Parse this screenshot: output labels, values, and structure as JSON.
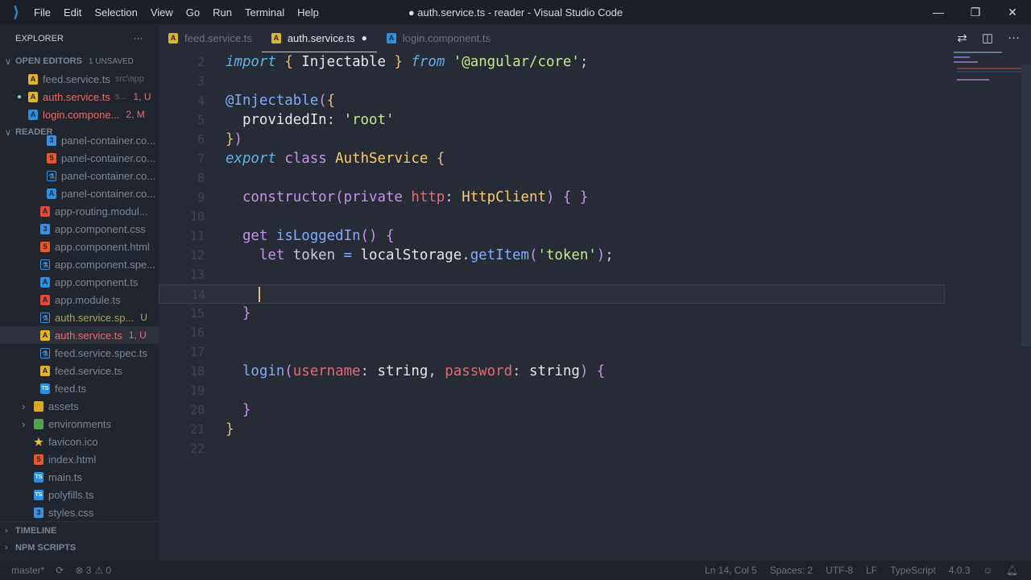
{
  "titlebar": {
    "title": "● auth.service.ts - reader - Visual Studio Code",
    "menu": [
      "File",
      "Edit",
      "Selection",
      "View",
      "Go",
      "Run",
      "Terminal",
      "Help"
    ]
  },
  "sidebar": {
    "explorer_label": "EXPLORER",
    "more": "···",
    "open_editors": {
      "label": "OPEN EDITORS",
      "sub": "1 UNSAVED",
      "items": [
        {
          "name": "feed.service.ts",
          "desc": "src\\app",
          "icon": "ang",
          "badge": "",
          "color": ""
        },
        {
          "name": "auth.service.ts",
          "desc": "s...",
          "icon": "ang",
          "badge": "1, U",
          "color": "red",
          "dirty": true
        },
        {
          "name": "login.compone...",
          "desc": "",
          "icon": "angb",
          "badge": "2, M",
          "color": "red"
        }
      ]
    },
    "reader": {
      "label": "READER",
      "items": [
        {
          "name": "panel-container.co...",
          "icon": "css",
          "indent": 2
        },
        {
          "name": "panel-container.co...",
          "icon": "html",
          "indent": 2
        },
        {
          "name": "panel-container.co...",
          "icon": "spec",
          "indent": 2
        },
        {
          "name": "panel-container.co...",
          "icon": "angb",
          "indent": 2
        },
        {
          "name": "app-routing.modul...",
          "icon": "angr",
          "indent": 1
        },
        {
          "name": "app.component.css",
          "icon": "css",
          "indent": 1
        },
        {
          "name": "app.component.html",
          "icon": "html",
          "indent": 1
        },
        {
          "name": "app.component.spe...",
          "icon": "spec",
          "indent": 1
        },
        {
          "name": "app.component.ts",
          "icon": "angb",
          "indent": 1
        },
        {
          "name": "app.module.ts",
          "icon": "angr",
          "indent": 1
        },
        {
          "name": "auth.service.sp...",
          "icon": "spec",
          "indent": 1,
          "badge": "U",
          "color": "olive"
        },
        {
          "name": "auth.service.ts",
          "icon": "ang",
          "indent": 1,
          "badge": "1, U",
          "color": "red",
          "active": true
        },
        {
          "name": "feed.service.spec.ts",
          "icon": "spec",
          "indent": 1
        },
        {
          "name": "feed.service.ts",
          "icon": "ang",
          "indent": 1
        },
        {
          "name": "feed.ts",
          "icon": "ts",
          "indent": 1
        },
        {
          "name": "assets",
          "icon": "fold",
          "indent": 0,
          "folder": true
        },
        {
          "name": "environments",
          "icon": "foldg",
          "indent": 0,
          "folder": true
        },
        {
          "name": "favicon.ico",
          "icon": "star",
          "indent": 0
        },
        {
          "name": "index.html",
          "icon": "html",
          "indent": 0
        },
        {
          "name": "main.ts",
          "icon": "ts",
          "indent": 0
        },
        {
          "name": "polyfills.ts",
          "icon": "ts",
          "indent": 0
        },
        {
          "name": "styles.css",
          "icon": "css",
          "indent": 0
        }
      ]
    },
    "timeline": "TIMELINE",
    "npm": "NPM SCRIPTS"
  },
  "tabs": [
    {
      "label": "feed.service.ts",
      "icon": "ang"
    },
    {
      "label": "auth.service.ts",
      "icon": "ang",
      "active": true,
      "dirty": "●"
    },
    {
      "label": "login.component.ts",
      "icon": "angb"
    }
  ],
  "colors": {
    "kw": "#5fb3e8",
    "brace": "#e5c07b",
    "id": "#e6e6e6",
    "str": "#c3e88d",
    "fn": "#82aaff",
    "pur": "#c792ea",
    "cls": "#ffcb6b",
    "par": "#e06c75",
    "pl": "#c8ccd4"
  },
  "code": [
    {
      "n": "2",
      "t": [
        [
          "import",
          "kw",
          1
        ],
        [
          " "
        ],
        [
          "{",
          "brace"
        ],
        [
          " Injectable ",
          "id"
        ],
        [
          "}",
          "brace"
        ],
        [
          " "
        ],
        [
          "from",
          "kw",
          1
        ],
        [
          " "
        ],
        [
          "'@angular/core'",
          "str"
        ],
        [
          ";",
          "pl"
        ]
      ]
    },
    {
      "n": "3",
      "t": []
    },
    {
      "n": "4",
      "t": [
        [
          "@Injectable",
          "fn"
        ],
        [
          "(",
          "pur"
        ],
        [
          "{",
          "brace"
        ]
      ]
    },
    {
      "n": "5",
      "t": [
        [
          "  providedIn",
          "id"
        ],
        [
          ": ",
          "pl"
        ],
        [
          "'root'",
          "str"
        ]
      ]
    },
    {
      "n": "6",
      "t": [
        [
          "}",
          "brace"
        ],
        [
          ")",
          "pur"
        ]
      ]
    },
    {
      "n": "7",
      "t": [
        [
          "export",
          "kw",
          1
        ],
        [
          " "
        ],
        [
          "class",
          "pur"
        ],
        [
          " "
        ],
        [
          "AuthService",
          "cls"
        ],
        [
          " "
        ],
        [
          "{",
          "brace"
        ]
      ]
    },
    {
      "n": "8",
      "t": []
    },
    {
      "n": "9",
      "t": [
        [
          "  constructor",
          "pur"
        ],
        [
          "(",
          "pur"
        ],
        [
          "private",
          "pur"
        ],
        [
          " "
        ],
        [
          "http",
          "par"
        ],
        [
          ": ",
          "pl"
        ],
        [
          "HttpClient",
          "cls"
        ],
        [
          ")",
          "pur"
        ],
        [
          " "
        ],
        [
          "{ }",
          "pur"
        ]
      ]
    },
    {
      "n": "10",
      "t": []
    },
    {
      "n": "11",
      "t": [
        [
          "  get",
          "pur"
        ],
        [
          " "
        ],
        [
          "isLoggedIn",
          "fn"
        ],
        [
          "()",
          "pur"
        ],
        [
          " "
        ],
        [
          "{",
          "pur"
        ]
      ]
    },
    {
      "n": "12",
      "t": [
        [
          "    let",
          "pur"
        ],
        [
          " token ",
          "pl"
        ],
        [
          "=",
          "fn"
        ],
        [
          " localStorage",
          "id"
        ],
        [
          ".",
          "pl"
        ],
        [
          "getItem",
          "fn"
        ],
        [
          "(",
          "pur"
        ],
        [
          "'token'",
          "str"
        ],
        [
          ")",
          "pur"
        ],
        [
          ";",
          "pl"
        ]
      ]
    },
    {
      "n": "13",
      "t": []
    },
    {
      "n": "14",
      "t": [],
      "cur": true
    },
    {
      "n": "15",
      "t": [
        [
          "  }",
          "pur"
        ]
      ]
    },
    {
      "n": "16",
      "t": []
    },
    {
      "n": "17",
      "t": []
    },
    {
      "n": "18",
      "t": [
        [
          "  login",
          "fn"
        ],
        [
          "(",
          "pur"
        ],
        [
          "username",
          "par"
        ],
        [
          ": ",
          "pl"
        ],
        [
          "string",
          "id"
        ],
        [
          ", ",
          "pl"
        ],
        [
          "password",
          "par"
        ],
        [
          ": ",
          "pl"
        ],
        [
          "string",
          "id"
        ],
        [
          ")",
          "pur"
        ],
        [
          " "
        ],
        [
          "{",
          "pur"
        ]
      ]
    },
    {
      "n": "19",
      "t": []
    },
    {
      "n": "20",
      "t": [
        [
          "  }",
          "pur"
        ]
      ]
    },
    {
      "n": "21",
      "t": [
        [
          "}",
          "brace"
        ]
      ]
    },
    {
      "n": "22",
      "t": []
    }
  ],
  "status": {
    "branch": "master*",
    "sync": "⟳",
    "errors": "⊗ 3",
    "warnings": "⚠ 0",
    "position": "Ln 14, Col 5",
    "spaces": "Spaces: 2",
    "encoding": "UTF-8",
    "eol": "LF",
    "language": "TypeScript",
    "version": "4.0.3"
  }
}
